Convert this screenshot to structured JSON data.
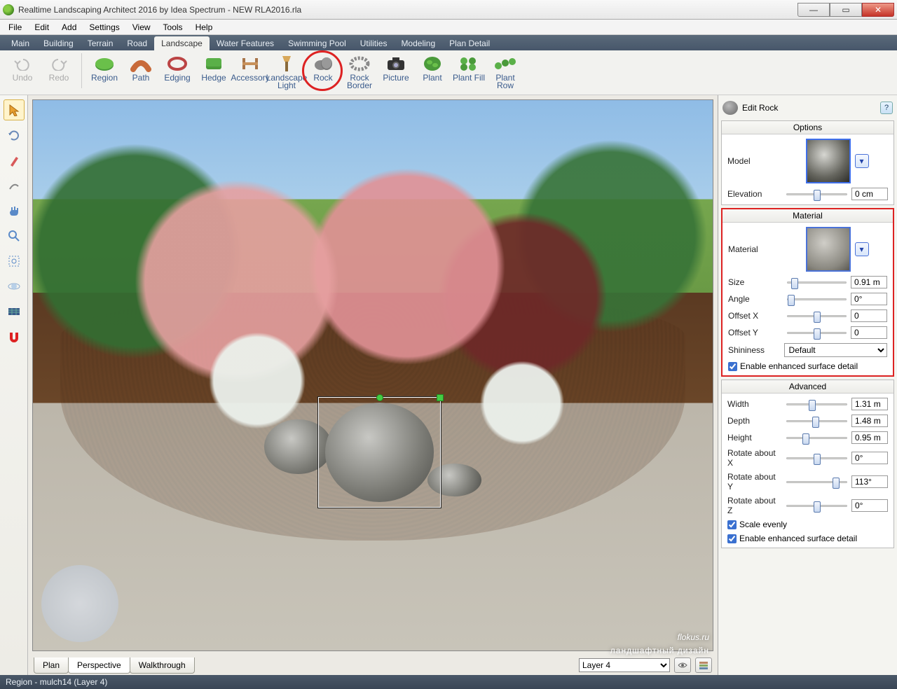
{
  "title": "Realtime Landscaping Architect 2016 by Idea Spectrum - NEW RLA2016.rla",
  "menu": [
    "File",
    "Edit",
    "Add",
    "Settings",
    "View",
    "Tools",
    "Help"
  ],
  "tabs": [
    "Main",
    "Building",
    "Terrain",
    "Road",
    "Landscape",
    "Water Features",
    "Swimming Pool",
    "Utilities",
    "Modeling",
    "Plan Detail"
  ],
  "active_tab": "Landscape",
  "toolbar": {
    "undo": "Undo",
    "redo": "Redo",
    "region": "Region",
    "path": "Path",
    "edging": "Edging",
    "hedge": "Hedge",
    "accessory": "Accessory",
    "landscape_light": "Landscape Light",
    "rock": "Rock",
    "rock_border": "Rock Border",
    "picture": "Picture",
    "plant": "Plant",
    "plant_fill": "Plant Fill",
    "plant_row": "Plant Row"
  },
  "view_tabs": {
    "plan": "Plan",
    "perspective": "Perspective",
    "walkthrough": "Walkthrough"
  },
  "layer": {
    "selected": "Layer 4",
    "options": [
      "Layer 4"
    ]
  },
  "panel": {
    "title": "Edit Rock",
    "options_hdr": "Options",
    "model_label": "Model",
    "elevation_label": "Elevation",
    "elevation_val": "0 cm",
    "material_hdr": "Material",
    "material_label": "Material",
    "size_label": "Size",
    "size_val": "0.91 m",
    "angle_label": "Angle",
    "angle_val": "0°",
    "offx_label": "Offset X",
    "offx_val": "0",
    "offy_label": "Offset Y",
    "offy_val": "0",
    "shininess_label": "Shininess",
    "shininess_val": "Default",
    "detail1_label": "Enable enhanced surface detail",
    "advanced_hdr": "Advanced",
    "width_label": "Width",
    "width_val": "1.31 m",
    "depth_label": "Depth",
    "depth_val": "1.48 m",
    "height_label": "Height",
    "height_val": "0.95 m",
    "rotx_label": "Rotate about X",
    "rotx_val": "0°",
    "roty_label": "Rotate about Y",
    "roty_val": "113°",
    "rotz_label": "Rotate about Z",
    "rotz_val": "0°",
    "scale_label": "Scale evenly",
    "detail2_label": "Enable enhanced surface detail"
  },
  "status": "Region - mulch14 (Layer 4)",
  "watermark": {
    "main": "flokus.ru",
    "sub": "ландшафтный дизайн"
  }
}
